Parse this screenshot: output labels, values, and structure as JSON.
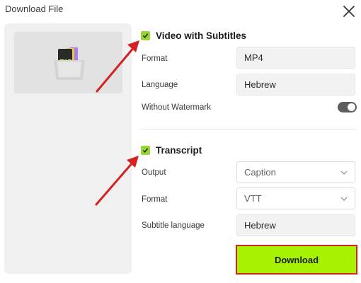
{
  "dialog": {
    "title": "Download File"
  },
  "icons": {
    "close": "close-icon",
    "zip": "zip-file-icon",
    "checkbox": "checkmark-icon",
    "dropdown": "chevron-down-icon"
  },
  "colors": {
    "checkbox": "#9bd43a",
    "download_button": "#a6f200",
    "highlight_border": "#d32222",
    "annotation_arrow": "#d32222",
    "toggle": "#5e5e5e"
  },
  "video_section": {
    "checkbox_checked": true,
    "title": "Video with Subtitles",
    "format_label": "Format",
    "format_value": "MP4",
    "language_label": "Language",
    "language_value": "Hebrew",
    "watermark_label": "Without Watermark",
    "watermark_enabled": true
  },
  "transcript_section": {
    "checkbox_checked": true,
    "title": "Transcript",
    "output_label": "Output",
    "output_value": "Caption",
    "format_label": "Format",
    "format_value": "VTT",
    "subtitle_language_label": "Subtitle language",
    "subtitle_language_value": "Hebrew"
  },
  "actions": {
    "download_label": "Download"
  }
}
